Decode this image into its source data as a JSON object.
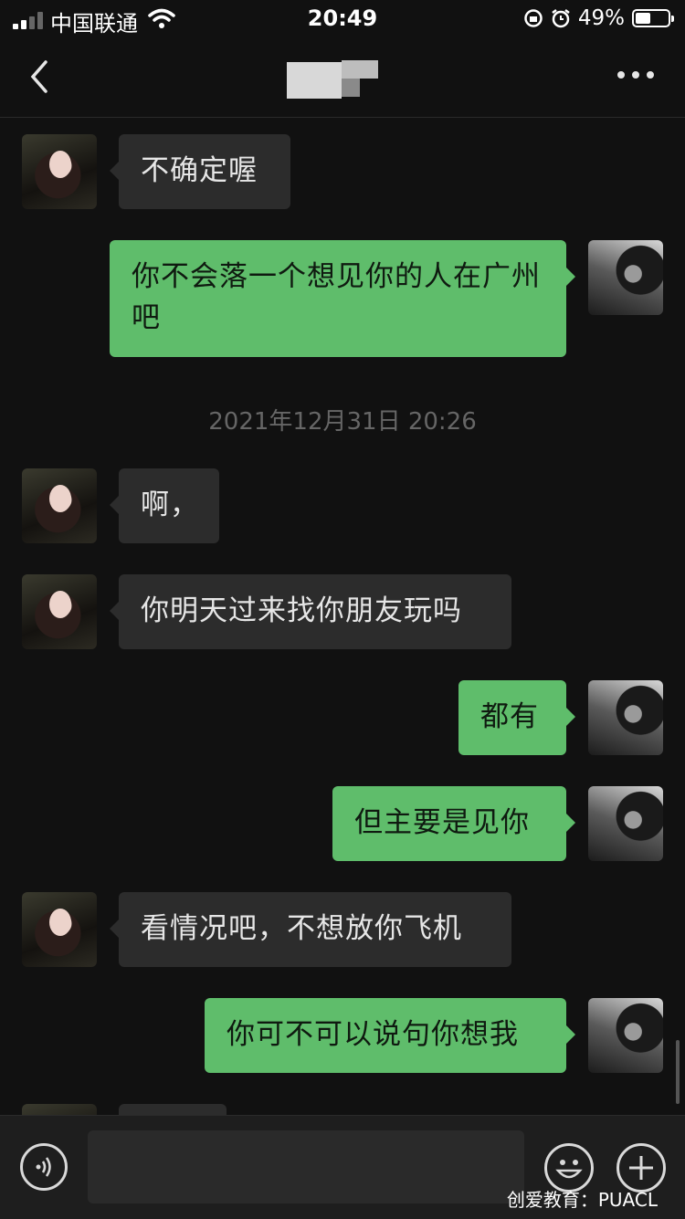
{
  "status_bar": {
    "carrier": "中国联通",
    "time": "20:49",
    "battery": "49%"
  },
  "nav": {
    "title_icon": "blurred-contact-name"
  },
  "messages": [
    {
      "side": "left",
      "text": "不确定喔"
    },
    {
      "side": "right",
      "text": "你不会落一个想见你的人在广州吧"
    },
    {
      "side": "left",
      "text": "啊，"
    },
    {
      "side": "left",
      "text": "你明天过来找你朋友玩吗"
    },
    {
      "side": "right",
      "text": "都有"
    },
    {
      "side": "right",
      "text": "但主要是见你"
    },
    {
      "side": "left",
      "text": "看情况吧，不想放你飞机"
    },
    {
      "side": "right",
      "text": "你可不可以说句你想我"
    }
  ],
  "timestamp": "2021年12月31日 20:26",
  "input": {
    "placeholder": ""
  },
  "watermark": "创爱教育：PUACL",
  "colors": {
    "background": "#111111",
    "incoming_bubble": "#2c2c2c",
    "outgoing_bubble": "#5fbd6b"
  }
}
